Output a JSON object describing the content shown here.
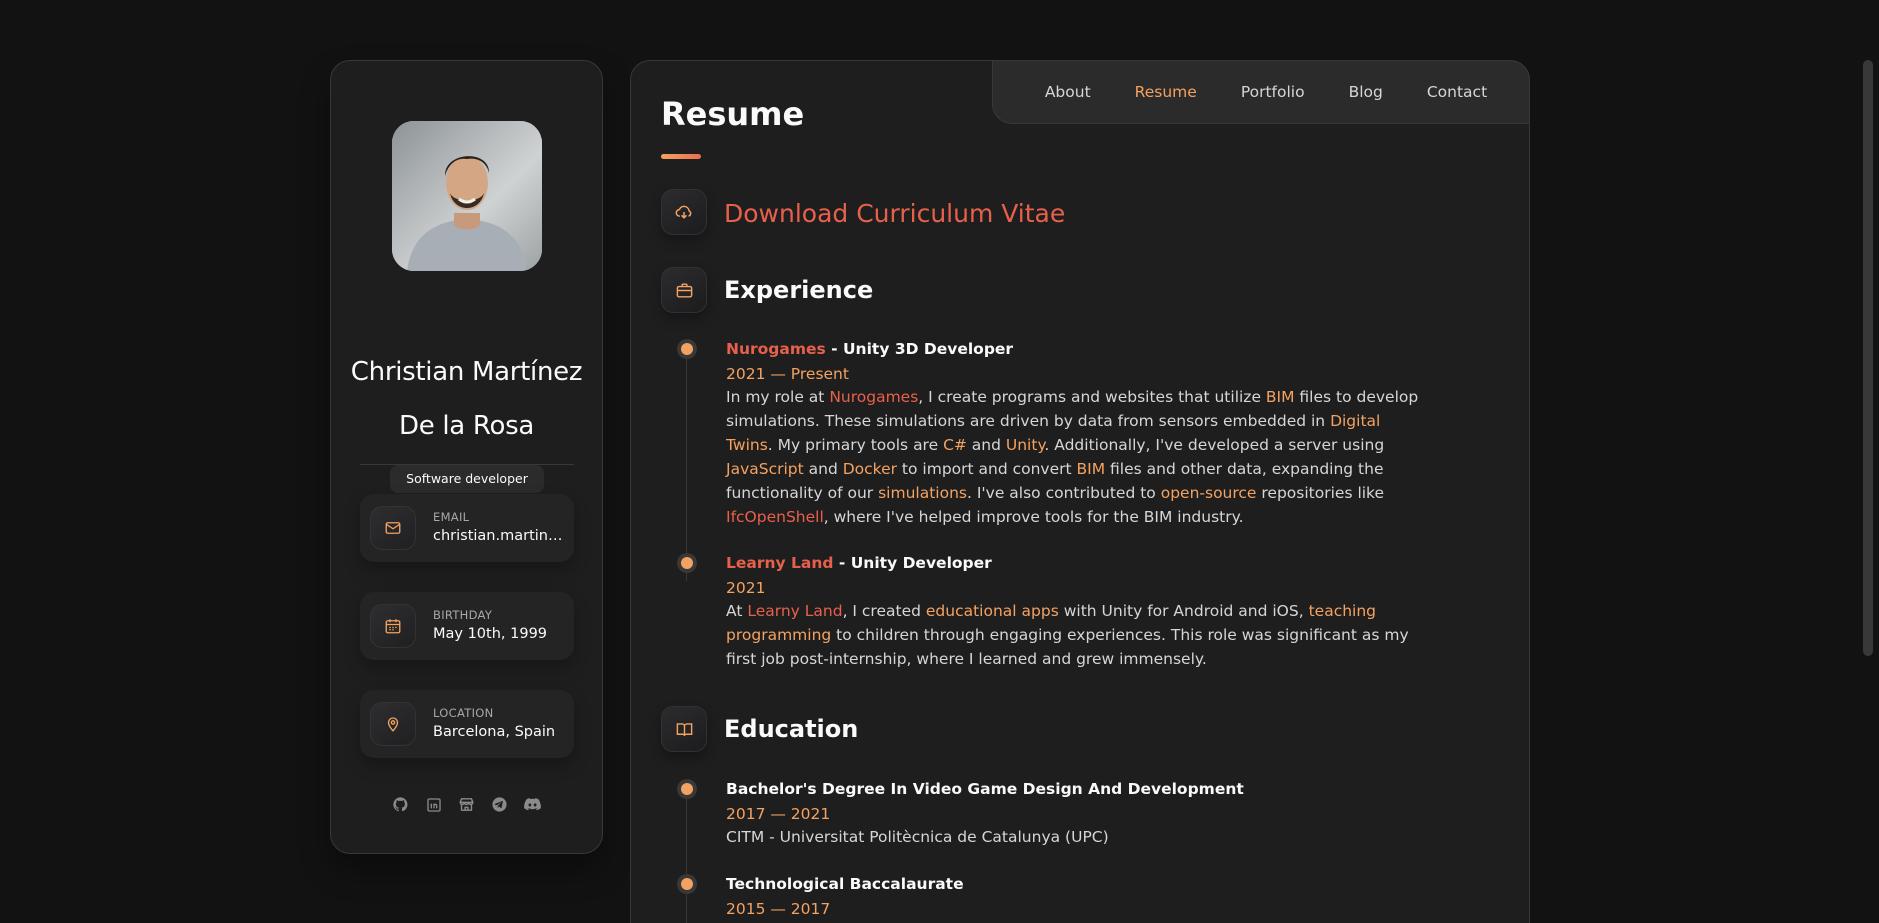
{
  "profile": {
    "name_line1": "Christian Martínez",
    "name_line2": "De la Rosa",
    "title": "Software developer",
    "contacts": [
      {
        "icon": "mail-icon",
        "label": "EMAIL",
        "value": "christian.martinez.delarosa"
      },
      {
        "icon": "calendar-icon",
        "label": "BIRTHDAY",
        "value": "May 10th, 1999"
      },
      {
        "icon": "location-pin-icon",
        "label": "LOCATION",
        "value": "Barcelona, Spain"
      }
    ],
    "socials": [
      "github-icon",
      "linkedin-icon",
      "store-icon",
      "telegram-icon",
      "discord-icon"
    ]
  },
  "nav": {
    "items": [
      "About",
      "Resume",
      "Portfolio",
      "Blog",
      "Contact"
    ],
    "active": "Resume"
  },
  "resume": {
    "title": "Resume",
    "download_label": "Download Curriculum Vitae",
    "experience_title": "Experience",
    "experience": [
      {
        "company": "Nurogames",
        "role": " - Unity 3D Developer",
        "date": "2021 — Present"
      },
      {
        "company": "Learny Land",
        "role": " - Unity Developer",
        "date": "2021"
      }
    ],
    "education_title": "Education",
    "education": [
      {
        "degree": "Bachelor's Degree In Video Game Design And Development",
        "date": "2017 — 2021",
        "school": "CITM - Universitat Politècnica de Catalunya (UPC)"
      },
      {
        "degree": "Technological Baccalaurate",
        "date": "2015 — 2017"
      }
    ],
    "exp1_desc": [
      "In my role at ",
      "Nurogames",
      ", I create programs and websites that utilize ",
      "BIM",
      " files to develop simulations. These simulations are driven by data from sensors embedded in ",
      "Digital Twins",
      ". My primary tools are ",
      "C#",
      " and ",
      "Unity",
      ". Additionally, I've developed a server using ",
      "JavaScript",
      " and ",
      "Docker",
      " to import and convert ",
      "BIM",
      " files and other data, expanding the functionality of our ",
      "simulations",
      ". I've also contributed to ",
      "open-source",
      " repositories like ",
      "IfcOpenShell",
      ", where I've helped improve tools for the BIM industry."
    ],
    "exp2_desc": [
      "At ",
      "Learny Land",
      ", I created ",
      "educational apps",
      " with Unity for Android and iOS, ",
      "teaching programming",
      " to children through engaging experiences. This role was significant as my first job post-internship, where I learned and grew immensely."
    ]
  },
  "colors": {
    "accent_orange": "#f4a261",
    "accent_red": "#e8604c",
    "background": "#121212",
    "panel": "#1e1e1f"
  }
}
